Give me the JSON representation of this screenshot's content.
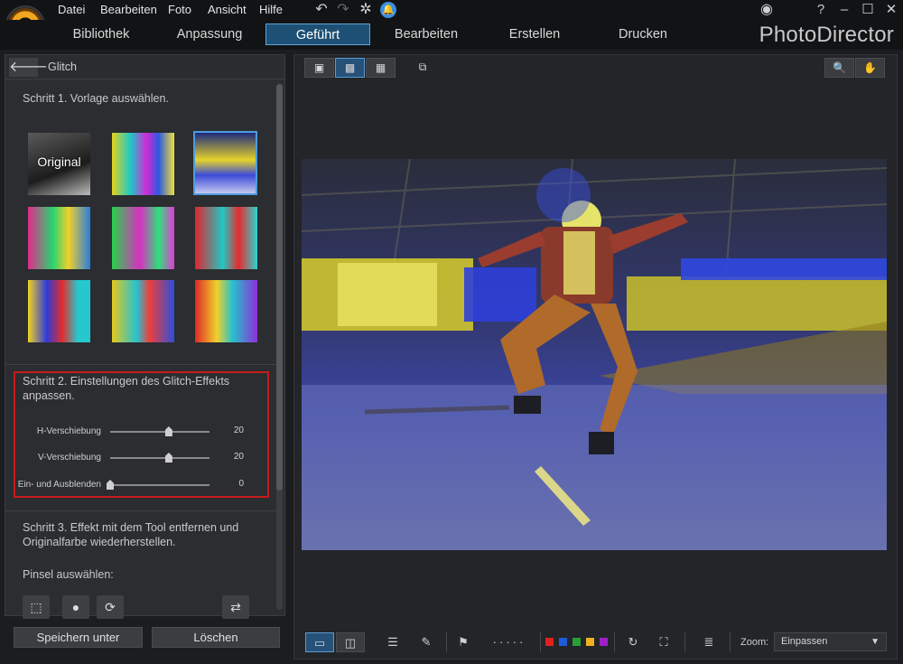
{
  "menu": {
    "datei": "Datei",
    "bearbeiten": "Bearbeiten",
    "foto": "Foto",
    "ansicht": "Ansicht",
    "hilfe": "Hilfe"
  },
  "modes": {
    "bibliothek": "Bibliothek",
    "anpassung": "Anpassung",
    "gefuehrt": "Geführt",
    "bearbeiten": "Bearbeiten",
    "erstellen": "Erstellen",
    "drucken": "Drucken"
  },
  "brand": "PhotoDirector",
  "panel": {
    "title": "Glitch",
    "step1": "Schritt 1. Vorlage auswählen.",
    "original_label": "Original",
    "step2": "Schritt 2. Einstellungen des Glitch-Effekts anpassen.",
    "sliders": [
      {
        "label": "H-Verschiebung",
        "value": "20",
        "fraction": 0.59
      },
      {
        "label": "V-Verschiebung",
        "value": "20",
        "fraction": 0.59
      },
      {
        "label": "Ein- und Ausblenden",
        "value": "0",
        "fraction": 0.0
      }
    ],
    "step3": "Schritt 3. Effekt mit dem Tool entfernen und Originalfarbe wiederherstellen.",
    "brush_label": "Pinsel auswählen:",
    "save_label": "Speichern unter",
    "delete_label": "Löschen"
  },
  "viewer": {
    "zoom_label": "Zoom:",
    "zoom_value": "Einpassen",
    "colors": [
      "#e02020",
      "#1e5bd8",
      "#28a038",
      "#f0b020",
      "#a020c8"
    ]
  },
  "icons": {
    "undo": "undo-icon",
    "redo": "redo-icon",
    "settings": "gear-icon",
    "notification": "bell-icon",
    "account": "user-icon",
    "help": "help-icon"
  }
}
